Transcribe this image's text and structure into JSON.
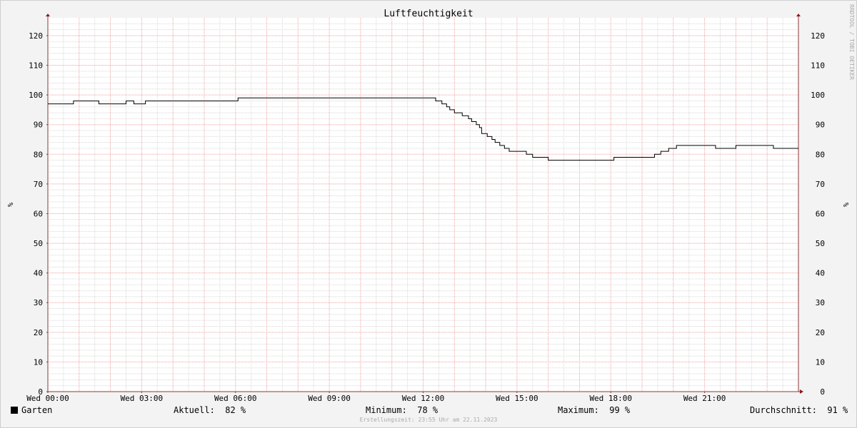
{
  "chart_data": {
    "type": "line",
    "title": "Luftfeuchtigkeit",
    "ylabel": "%",
    "ylim": [
      0,
      126
    ],
    "yticks": [
      0,
      10,
      20,
      30,
      40,
      50,
      60,
      70,
      80,
      90,
      100,
      110,
      120
    ],
    "xlim": [
      0,
      24
    ],
    "xticks": [
      {
        "x": 0,
        "label": "Wed 00:00"
      },
      {
        "x": 3,
        "label": "Wed 03:00"
      },
      {
        "x": 6,
        "label": "Wed 06:00"
      },
      {
        "x": 9,
        "label": "Wed 09:00"
      },
      {
        "x": 12,
        "label": "Wed 12:00"
      },
      {
        "x": 15,
        "label": "Wed 15:00"
      },
      {
        "x": 18,
        "label": "Wed 18:00"
      },
      {
        "x": 21,
        "label": "Wed 21:00"
      }
    ],
    "grid": true,
    "series": [
      {
        "name": "Garten",
        "color": "#000000",
        "step": true,
        "x": [
          0,
          0.82,
          1.63,
          2.5,
          2.75,
          3.12,
          6.0,
          6.08,
          12.4,
          12.6,
          12.75,
          12.85,
          12.92,
          13.0,
          13.05,
          13.25,
          13.45,
          13.55,
          13.7,
          13.8,
          13.87,
          14.05,
          14.2,
          14.3,
          14.45,
          14.6,
          14.75,
          14.95,
          15.3,
          15.5,
          16.0,
          17.0,
          18.1,
          19.0,
          19.4,
          19.6,
          19.85,
          20.1,
          21.0,
          21.35,
          22.0,
          23.2,
          24.0
        ],
        "y": [
          97,
          98,
          97,
          98,
          97,
          98,
          98,
          99,
          98,
          97,
          96,
          95,
          95,
          94,
          94,
          93,
          92,
          91,
          90,
          89,
          87,
          86,
          85,
          84,
          83,
          82,
          81,
          81,
          80,
          79,
          78,
          78,
          79,
          79,
          80,
          81,
          82,
          83,
          83,
          82,
          83,
          82,
          82
        ]
      }
    ]
  },
  "watermark": "RRDTOOL / TOBI OETIKER",
  "legend": {
    "series_name": "Garten",
    "current": "Aktuell:  82 %",
    "minimum": "Minimum:  78 %",
    "maximum": "Maximum:  99 %",
    "average": "Durchschnitt:  91 %"
  },
  "footer": "Erstellungszeit: 23:55 Uhr am 22.11.2023"
}
